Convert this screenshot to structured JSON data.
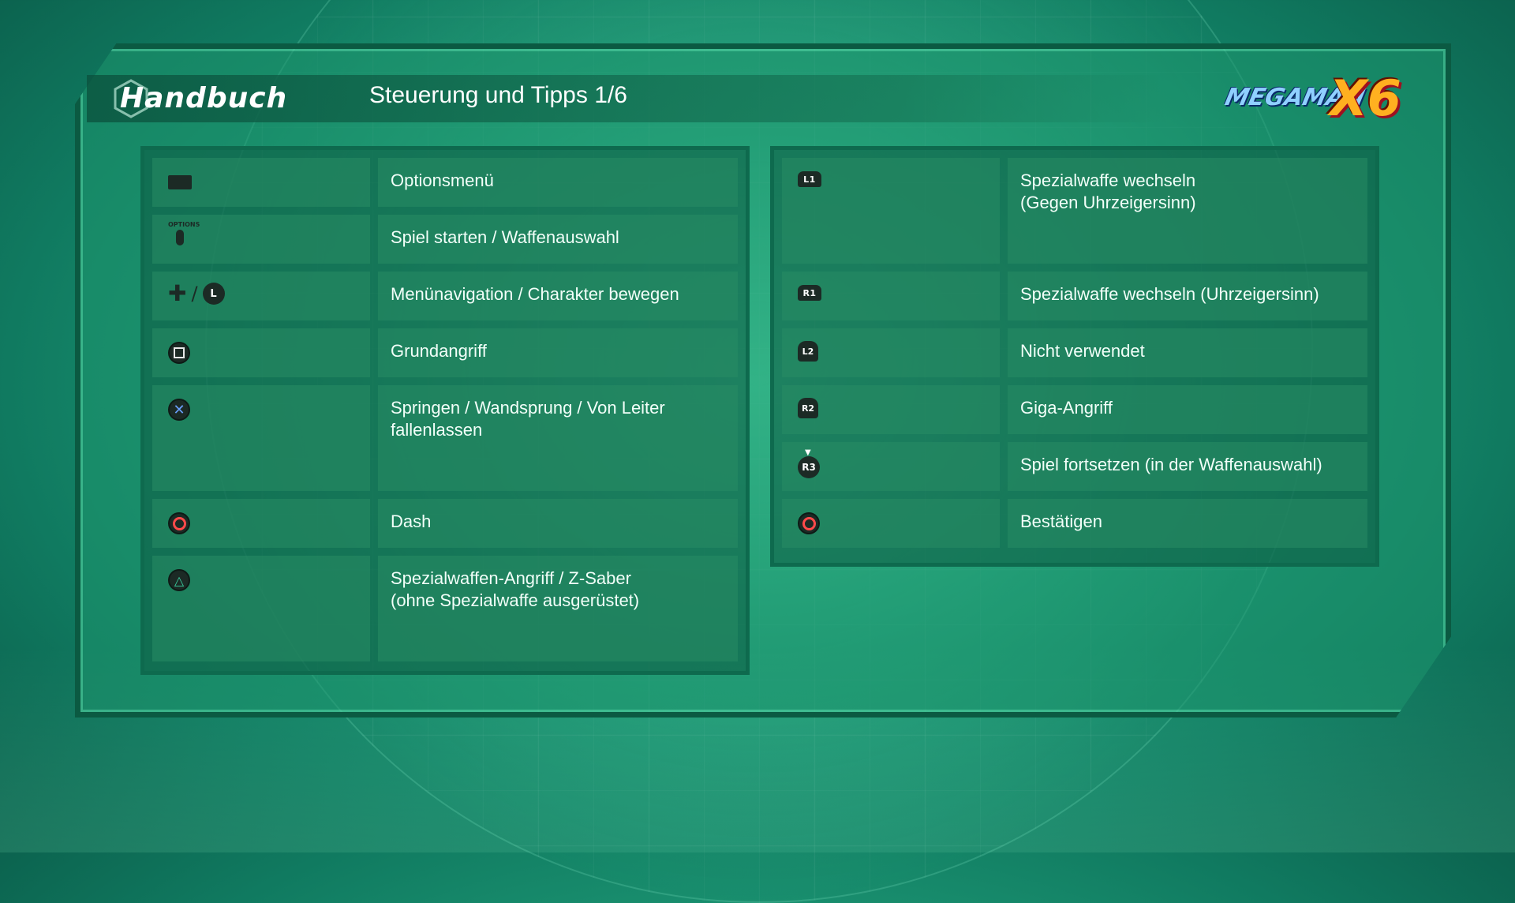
{
  "header": {
    "manual_title": "Handbuch",
    "page_subtitle": "Steuerung und Tipps 1/6",
    "logo_text_main": "MEGAMAN",
    "logo_text_x6": "X6"
  },
  "left_rows": [
    {
      "icon": "touchpad-button-icon",
      "label": "Optionsmenü"
    },
    {
      "icon": "options-button-icon",
      "icon_caption": "OPTIONS",
      "label": "Spiel starten / Waffenauswahl"
    },
    {
      "icon": "dpad-or-left-stick-icon",
      "icon_separator": "/",
      "icon_stick": "L",
      "label": "Menünavigation / Charakter bewegen"
    },
    {
      "icon": "square-button-icon",
      "label": "Grundangriff"
    },
    {
      "icon": "cross-button-icon",
      "label": "Springen / Wandsprung / Von Leiter\nfallenlassen"
    },
    {
      "icon": "circle-button-icon",
      "label": "Dash"
    },
    {
      "icon": "triangle-button-icon",
      "label": "Spezialwaffen-Angriff / Z-Saber\n(ohne Spezialwaffe ausgerüstet)"
    }
  ],
  "right_rows": [
    {
      "icon": "l1-button-icon",
      "icon_label": "L1",
      "label": "Spezialwaffe wechseln\n(Gegen Uhrzeigersinn)"
    },
    {
      "icon": "r1-button-icon",
      "icon_label": "R1",
      "label": "Spezialwaffe wechseln (Uhrzeigersinn)"
    },
    {
      "icon": "l2-button-icon",
      "icon_label": "L2",
      "label": "Nicht verwendet"
    },
    {
      "icon": "r2-button-icon",
      "icon_label": "R2",
      "label": "Giga-Angriff"
    },
    {
      "icon": "r3-button-icon",
      "icon_label": "R3",
      "label": "Spiel fortsetzen (in der Waffenauswahl)"
    },
    {
      "icon": "circle-button-icon",
      "label": "Bestätigen"
    }
  ],
  "colors": {
    "background": "#1e9a76",
    "panel": "#0e6a4e",
    "cell": "#2a8c64",
    "circle_button": "#ff4a4a",
    "cross_button": "#6aa0ff",
    "triangle_button": "#3ad0a0",
    "square_button": "#e8e8e8"
  }
}
